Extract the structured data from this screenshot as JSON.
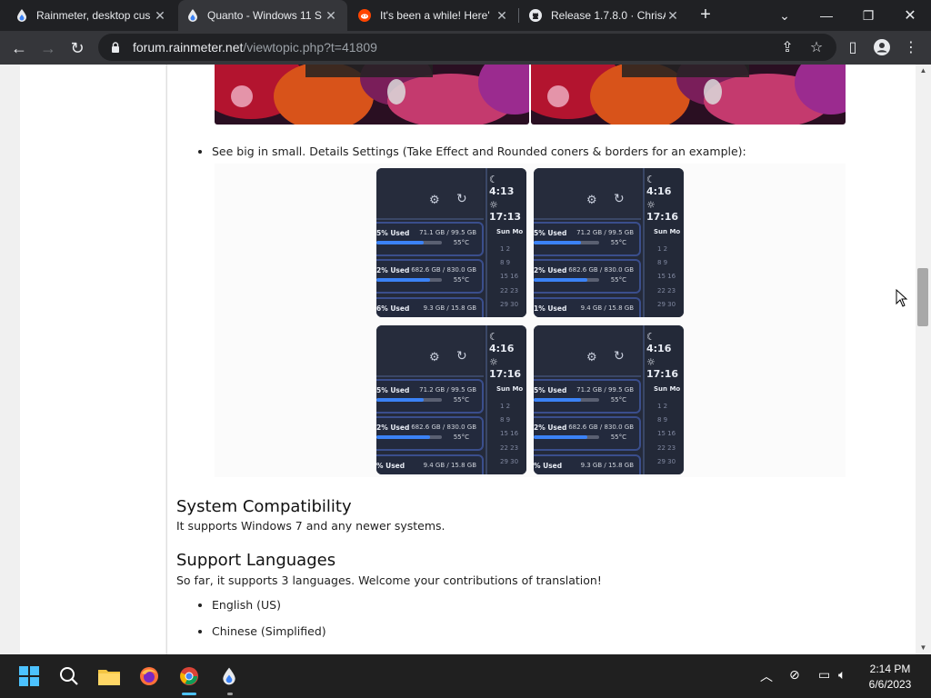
{
  "browser": {
    "tabs": [
      {
        "title": "Rainmeter, desktop cus",
        "active": false,
        "favicon": "rainmeter-drop-icon"
      },
      {
        "title": "Quanto - Windows 11 S",
        "active": true,
        "favicon": "rainmeter-drop-icon"
      },
      {
        "title": "It's been a while! Here'",
        "active": false,
        "favicon": "reddit-icon"
      },
      {
        "title": "Release 1.7.8.0 · ChrisA",
        "active": false,
        "favicon": "github-icon"
      }
    ],
    "new_tab": "+",
    "url_host": "forum.rainmeter.net",
    "url_path": "/viewtopic.php?t=41809"
  },
  "post": {
    "bullet_preview": "See big in small. Details Settings (Take Effect and Rounded coners & borders for an example):",
    "shots": [
      {
        "clock1": "4:13",
        "clock2": "17:13",
        "disks": [
          {
            "used": "5% Used",
            "size": "71.1 GB / 99.5 GB",
            "temp": "55°C",
            "fill": 0.72
          },
          {
            "used": "2% Used",
            "size": "682.6 GB / 830.0 GB",
            "temp": "55°C",
            "fill": 0.82
          },
          {
            "used": "6% Used",
            "size": "9.3 GB / 15.8 GB"
          }
        ]
      },
      {
        "clock1": "4:16",
        "clock2": "17:16",
        "disks": [
          {
            "used": "5% Used",
            "size": "71.2 GB / 99.5 GB",
            "temp": "55°C",
            "fill": 0.72
          },
          {
            "used": "2% Used",
            "size": "682.6 GB / 830.0 GB",
            "temp": "55°C",
            "fill": 0.82
          },
          {
            "used": "1% Used",
            "size": "9.4 GB / 15.8 GB"
          }
        ]
      },
      {
        "clock1": "4:16",
        "clock2": "17:16",
        "disks": [
          {
            "used": "5% Used",
            "size": "71.2 GB / 99.5 GB",
            "temp": "55°C",
            "fill": 0.72
          },
          {
            "used": "2% Used",
            "size": "682.6 GB / 830.0 GB",
            "temp": "55°C",
            "fill": 0.82
          },
          {
            "used": "% Used",
            "size": "9.4 GB / 15.8 GB"
          }
        ]
      },
      {
        "clock1": "4:16",
        "clock2": "17:16",
        "disks": [
          {
            "used": "5% Used",
            "size": "71.2 GB / 99.5 GB",
            "temp": "55°C",
            "fill": 0.72
          },
          {
            "used": "2% Used",
            "size": "682.6 GB / 830.0 GB",
            "temp": "55°C",
            "fill": 0.82
          },
          {
            "used": "% Used",
            "size": "9.3 GB / 15.8 GB"
          }
        ]
      }
    ],
    "calendar_days": "Sun  Mo",
    "calendar_numbers": [
      "1  2",
      "8  9",
      "15  16",
      "22  23",
      "29  30"
    ],
    "system_compat_heading": "System Compatibility",
    "system_compat_text": "It supports Windows 7 and any newer systems.",
    "languages_heading": "Support Languages",
    "languages_text": "So far, it supports 3 languages. Welcome your contributions of translation!",
    "languages": [
      "English (US)",
      "Chinese (Simplified)"
    ]
  },
  "taskbar": {
    "time": "2:14 PM",
    "date": "6/6/2023"
  }
}
